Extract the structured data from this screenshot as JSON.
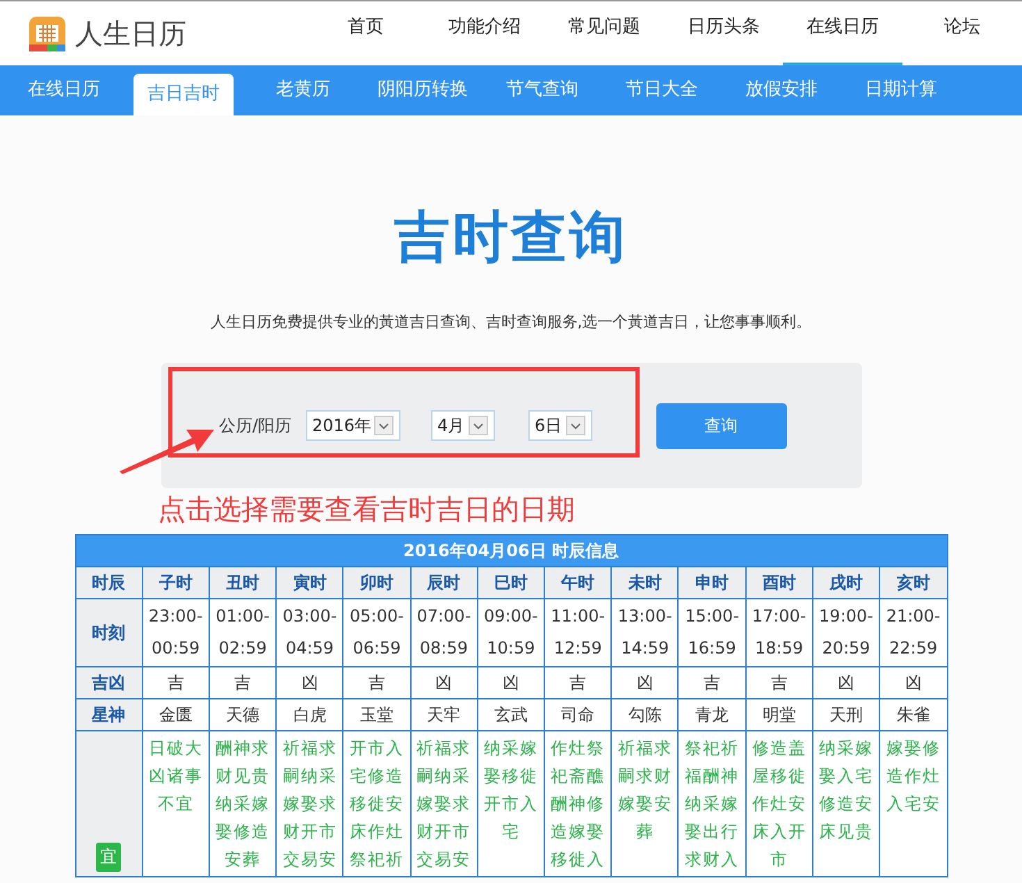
{
  "brand": {
    "name": "人生日历"
  },
  "top_nav": [
    {
      "label": "首页",
      "selected": false
    },
    {
      "label": "功能介绍",
      "selected": false
    },
    {
      "label": "常见问题",
      "selected": false
    },
    {
      "label": "日历头条",
      "selected": false
    },
    {
      "label": "在线日历",
      "selected": true
    },
    {
      "label": "论坛",
      "selected": false
    }
  ],
  "sub_nav": [
    {
      "label": "在线日历",
      "selected": false
    },
    {
      "label": "吉日吉时",
      "selected": true
    },
    {
      "label": "老黄历",
      "selected": false
    },
    {
      "label": "阴阳历转换",
      "selected": false
    },
    {
      "label": "节气查询",
      "selected": false
    },
    {
      "label": "节日大全",
      "selected": false
    },
    {
      "label": "放假安排",
      "selected": false
    },
    {
      "label": "日期计算",
      "selected": false
    }
  ],
  "heading": "吉时查询",
  "description": "人生日历免费提供专业的黃道吉日查询、吉时查询服务,选一个黃道吉日，让您事事顺利。",
  "form": {
    "label": "公历/阳历",
    "year": "2016年",
    "month": "4月",
    "day": "6日",
    "button": "查询"
  },
  "annotation": {
    "text": "点击选择需要查看吉时吉日的日期"
  },
  "table": {
    "title": "2016年04月06日 时辰信息",
    "row_labels": [
      "时辰",
      "时刻",
      "吉凶",
      "星神"
    ],
    "yi_label": "宜",
    "columns": [
      {
        "name": "子时",
        "time": "23:00-00:59",
        "luck": "吉",
        "star": "金匮",
        "yi": "日破大凶诸事不宜"
      },
      {
        "name": "丑时",
        "time": "01:00-02:59",
        "luck": "吉",
        "star": "天德",
        "yi": "酬神求财见贵纳采嫁娶修造安葬"
      },
      {
        "name": "寅时",
        "time": "03:00-04:59",
        "luck": "凶",
        "star": "白虎",
        "yi": "祈福求嗣纳采嫁娶求财开市交易安"
      },
      {
        "name": "卯时",
        "time": "05:00-06:59",
        "luck": "吉",
        "star": "玉堂",
        "yi": "开市入宅修造移徙安床作灶祭祀祈"
      },
      {
        "name": "辰时",
        "time": "07:00-08:59",
        "luck": "凶",
        "star": "天牢",
        "yi": "祈福求嗣纳采嫁娶求财开市交易安"
      },
      {
        "name": "巳时",
        "time": "09:00-10:59",
        "luck": "凶",
        "star": "玄武",
        "yi": "纳采嫁娶移徙开市入宅"
      },
      {
        "name": "午时",
        "time": "11:00-12:59",
        "luck": "吉",
        "star": "司命",
        "yi": "作灶祭祀斋醮酬神修造嫁娶移徙入"
      },
      {
        "name": "未时",
        "time": "13:00-14:59",
        "luck": "凶",
        "star": "勾陈",
        "yi": "祈福求嗣求财嫁娶安葬"
      },
      {
        "name": "申时",
        "time": "15:00-16:59",
        "luck": "吉",
        "star": "青龙",
        "yi": "祭祀祈福酬神纳采嫁娶出行求财入"
      },
      {
        "name": "酉时",
        "time": "17:00-18:59",
        "luck": "吉",
        "star": "明堂",
        "yi": "修造盖屋移徙作灶安床入开市"
      },
      {
        "name": "戌时",
        "time": "19:00-20:59",
        "luck": "凶",
        "star": "天刑",
        "yi": "纳采嫁娶入宅修造安床见贵"
      },
      {
        "name": "亥时",
        "time": "21:00-22:59",
        "luck": "凶",
        "star": "朱雀",
        "yi": "嫁娶修造作灶入宅安"
      }
    ]
  }
}
